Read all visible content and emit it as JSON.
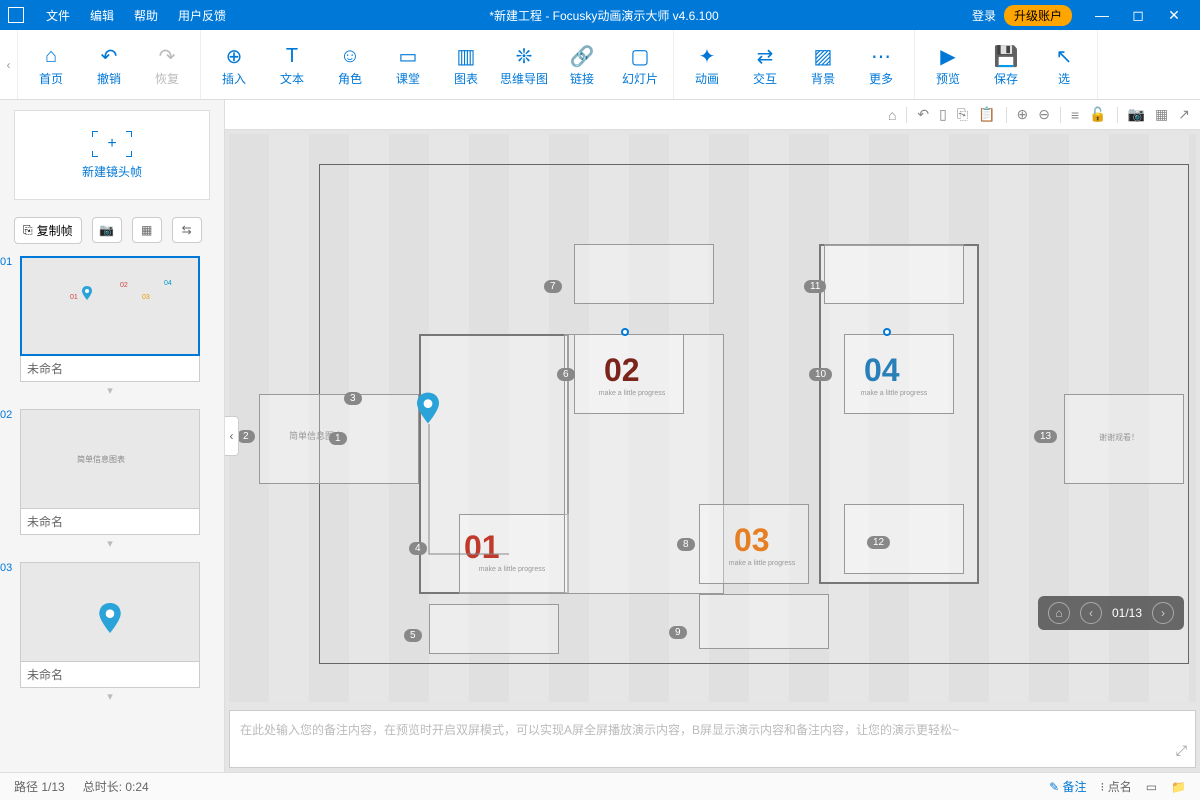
{
  "titlebar": {
    "menus": [
      "文件",
      "编辑",
      "帮助",
      "用户反馈"
    ],
    "title": "*新建工程 - Focusky动画演示大师  v4.6.100",
    "login": "登录",
    "upgrade": "升级账户"
  },
  "toolbar": {
    "home": "首页",
    "undo": "撤销",
    "redo": "恢复",
    "insert": "插入",
    "text": "文本",
    "role": "角色",
    "class": "课堂",
    "chart": "图表",
    "mindmap": "思维导图",
    "link": "链接",
    "slide": "幻灯片",
    "anim": "动画",
    "interact": "交互",
    "bg": "背景",
    "more": "更多",
    "preview": "预览",
    "save": "保存",
    "select": "选"
  },
  "sidebar": {
    "newframe": "新建镜头帧",
    "copyframe": "复制帧",
    "slides": [
      {
        "num": "01",
        "label": "未命名"
      },
      {
        "num": "02",
        "label": "未命名"
      },
      {
        "num": "03",
        "label": "未命名"
      }
    ]
  },
  "canvas": {
    "nums": {
      "n01": "01",
      "n02": "02",
      "n03": "03",
      "n04": "04"
    },
    "badges": {
      "b1": "1",
      "b2": "2",
      "b3": "3",
      "b4": "4",
      "b5": "5",
      "b6": "6",
      "b7": "7",
      "b8": "8",
      "b9": "9",
      "b10": "10",
      "b11": "11",
      "b12": "12",
      "b13": "13"
    },
    "txt1": "简单信息图表",
    "txt2": "谢谢观看！"
  },
  "nav": {
    "counter": "01/13"
  },
  "notes": {
    "placeholder": "在此处输入您的备注内容，在预览时开启双屏模式，可以实现A屏全屏播放演示内容，B屏显示演示内容和备注内容，让您的演示更轻松~"
  },
  "status": {
    "path": "路径 1/13",
    "duration": "总时长: 0:24",
    "remark": "备注",
    "dots": "点名"
  },
  "thumb": {
    "t01": "01",
    "t02": "02",
    "t03": "03",
    "t04": "04",
    "slide2": "简单信息图表"
  }
}
